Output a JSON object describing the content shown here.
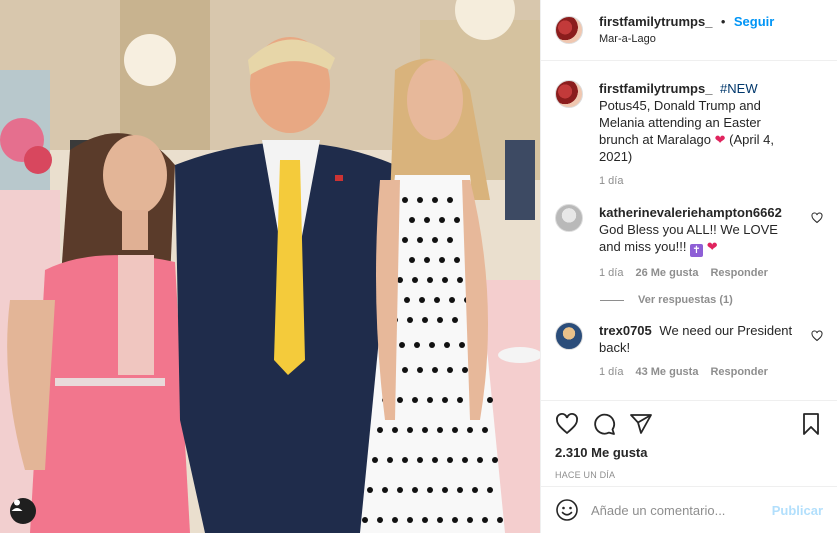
{
  "header": {
    "username": "firstfamilytrumps_",
    "separator": "•",
    "follow_label": "Seguir",
    "location": "Mar-a-Lago"
  },
  "caption": {
    "username": "firstfamilytrumps_",
    "hashtag": "#NEW",
    "text": "Potus45, Donald Trump and Melania attending an Easter brunch at Maralago",
    "heart": "❤",
    "date_text": "(April 4, 2021)",
    "time": "1 día"
  },
  "comments": [
    {
      "username": "katherinevaleriehampton6662",
      "text": "God Bless you ALL!! We LOVE and miss you!!!",
      "cross": "✝",
      "heart": "❤",
      "time": "1 día",
      "likes": "26 Me gusta",
      "reply_label": "Responder",
      "view_replies": "Ver respuestas (1)"
    },
    {
      "username": "trex0705",
      "text": "We need our President back!",
      "time": "1 día",
      "likes": "43 Me gusta",
      "reply_label": "Responder"
    }
  ],
  "actions": {
    "likes": "2.310 Me gusta",
    "timestamp": "HACE UN DÍA"
  },
  "add_comment": {
    "placeholder": "Añade un comentario...",
    "publish_label": "Publicar"
  },
  "colors": {
    "accent": "#0095f6",
    "publish_disabled": "#b2dffc",
    "muted": "#8e8e8e",
    "heart": "#e0245e"
  },
  "icons": [
    "user-tag-icon",
    "heart-icon",
    "comment-icon",
    "share-icon",
    "save-icon",
    "emoji-icon"
  ]
}
